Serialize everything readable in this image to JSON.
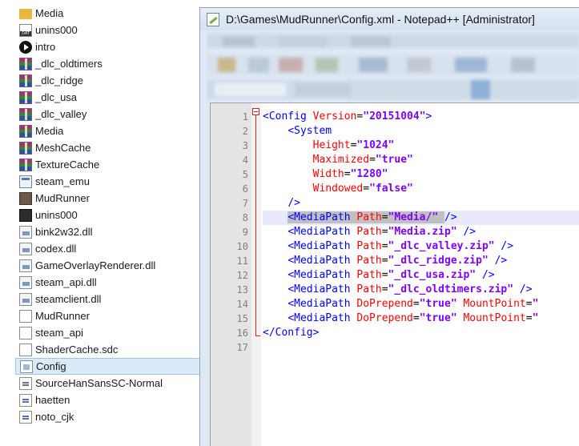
{
  "explorer": {
    "items": [
      {
        "label": "Media",
        "icon": "folder-icon"
      },
      {
        "label": "unins000",
        "icon": "dat-file-icon"
      },
      {
        "label": "intro",
        "icon": "video-play-icon"
      },
      {
        "label": "_dlc_oldtimers",
        "icon": "rar-archive-icon"
      },
      {
        "label": "_dlc_ridge",
        "icon": "rar-archive-icon"
      },
      {
        "label": "_dlc_usa",
        "icon": "rar-archive-icon"
      },
      {
        "label": "_dlc_valley",
        "icon": "rar-archive-icon"
      },
      {
        "label": "Media",
        "icon": "rar-archive-icon"
      },
      {
        "label": "MeshCache",
        "icon": "rar-archive-icon"
      },
      {
        "label": "TextureCache",
        "icon": "rar-archive-icon"
      },
      {
        "label": "steam_emu",
        "icon": "application-icon"
      },
      {
        "label": "MudRunner",
        "icon": "game-app-icon"
      },
      {
        "label": "unins000",
        "icon": "setup-app-icon"
      },
      {
        "label": "bink2w32.dll",
        "icon": "dll-file-icon"
      },
      {
        "label": "codex.dll",
        "icon": "dll-file-icon"
      },
      {
        "label": "GameOverlayRenderer.dll",
        "icon": "dll-file-icon"
      },
      {
        "label": "steam_api.dll",
        "icon": "dll-file-icon"
      },
      {
        "label": "steamclient.dll",
        "icon": "dll-file-icon"
      },
      {
        "label": "MudRunner",
        "icon": "blank-file-icon"
      },
      {
        "label": "steam_api",
        "icon": "blank-file-icon"
      },
      {
        "label": "ShaderCache.sdc",
        "icon": "blank-file-icon"
      },
      {
        "label": "Config",
        "icon": "config-file-icon",
        "selected": true
      },
      {
        "label": "SourceHanSansSC-Normal",
        "icon": "font-file-icon"
      },
      {
        "label": "haetten",
        "icon": "font-file-icon"
      },
      {
        "label": "noto_cjk",
        "icon": "font-file-icon"
      }
    ]
  },
  "notepad": {
    "title": "D:\\Games\\MudRunner\\Config.xml - Notepad++ [Administrator]",
    "highlighted_line": 8,
    "lines": [
      {
        "n": "1",
        "tokens": [
          {
            "t": "<Config ",
            "c": "tag"
          },
          {
            "t": "Version",
            "c": "attr"
          },
          {
            "t": "=",
            "c": "eq"
          },
          {
            "t": "\"20151004\"",
            "c": "val"
          },
          {
            "t": ">",
            "c": "tag"
          }
        ]
      },
      {
        "n": "2",
        "tokens": [
          {
            "t": "    ",
            "c": "eq"
          },
          {
            "t": "<System",
            "c": "tag"
          }
        ]
      },
      {
        "n": "3",
        "tokens": [
          {
            "t": "        ",
            "c": "eq"
          },
          {
            "t": "Height",
            "c": "attr"
          },
          {
            "t": "=",
            "c": "eq"
          },
          {
            "t": "\"1024\"",
            "c": "val"
          }
        ]
      },
      {
        "n": "4",
        "tokens": [
          {
            "t": "        ",
            "c": "eq"
          },
          {
            "t": "Maximized",
            "c": "attr"
          },
          {
            "t": "=",
            "c": "eq"
          },
          {
            "t": "\"true\"",
            "c": "val"
          }
        ]
      },
      {
        "n": "5",
        "tokens": [
          {
            "t": "        ",
            "c": "eq"
          },
          {
            "t": "Width",
            "c": "attr"
          },
          {
            "t": "=",
            "c": "eq"
          },
          {
            "t": "\"1280\"",
            "c": "val"
          }
        ]
      },
      {
        "n": "6",
        "tokens": [
          {
            "t": "        ",
            "c": "eq"
          },
          {
            "t": "Windowed",
            "c": "attr"
          },
          {
            "t": "=",
            "c": "eq"
          },
          {
            "t": "\"false\"",
            "c": "val"
          }
        ]
      },
      {
        "n": "7",
        "tokens": [
          {
            "t": "    ",
            "c": "eq"
          },
          {
            "t": "/>",
            "c": "tag"
          }
        ]
      },
      {
        "n": "8",
        "tokens": [
          {
            "t": "    ",
            "c": "eq"
          },
          {
            "t": "<MediaPath ",
            "c": "tag",
            "sel": true
          },
          {
            "t": "Path",
            "c": "attr",
            "sel": true
          },
          {
            "t": "=",
            "c": "eq",
            "sel": true
          },
          {
            "t": "\"Media/\"",
            "c": "val",
            "sel": true
          },
          {
            "t": " ",
            "c": "eq",
            "sel": true
          },
          {
            "t": "/>",
            "c": "tag"
          }
        ]
      },
      {
        "n": "9",
        "tokens": [
          {
            "t": "    ",
            "c": "eq"
          },
          {
            "t": "<MediaPath ",
            "c": "tag"
          },
          {
            "t": "Path",
            "c": "attr"
          },
          {
            "t": "=",
            "c": "eq"
          },
          {
            "t": "\"Media.zip\"",
            "c": "val"
          },
          {
            "t": " />",
            "c": "tag"
          }
        ]
      },
      {
        "n": "10",
        "tokens": [
          {
            "t": "    ",
            "c": "eq"
          },
          {
            "t": "<MediaPath ",
            "c": "tag"
          },
          {
            "t": "Path",
            "c": "attr"
          },
          {
            "t": "=",
            "c": "eq"
          },
          {
            "t": "\"_dlc_valley.zip\"",
            "c": "val"
          },
          {
            "t": " />",
            "c": "tag"
          }
        ]
      },
      {
        "n": "11",
        "tokens": [
          {
            "t": "    ",
            "c": "eq"
          },
          {
            "t": "<MediaPath ",
            "c": "tag"
          },
          {
            "t": "Path",
            "c": "attr"
          },
          {
            "t": "=",
            "c": "eq"
          },
          {
            "t": "\"_dlc_ridge.zip\"",
            "c": "val"
          },
          {
            "t": " />",
            "c": "tag"
          }
        ]
      },
      {
        "n": "12",
        "tokens": [
          {
            "t": "    ",
            "c": "eq"
          },
          {
            "t": "<MediaPath ",
            "c": "tag"
          },
          {
            "t": "Path",
            "c": "attr"
          },
          {
            "t": "=",
            "c": "eq"
          },
          {
            "t": "\"_dlc_usa.zip\"",
            "c": "val"
          },
          {
            "t": " />",
            "c": "tag"
          }
        ]
      },
      {
        "n": "13",
        "tokens": [
          {
            "t": "    ",
            "c": "eq"
          },
          {
            "t": "<MediaPath ",
            "c": "tag"
          },
          {
            "t": "Path",
            "c": "attr"
          },
          {
            "t": "=",
            "c": "eq"
          },
          {
            "t": "\"_dlc_oldtimers.zip\"",
            "c": "val"
          },
          {
            "t": " />",
            "c": "tag"
          }
        ]
      },
      {
        "n": "14",
        "tokens": [
          {
            "t": "    ",
            "c": "eq"
          },
          {
            "t": "<MediaPath ",
            "c": "tag"
          },
          {
            "t": "DoPrepend",
            "c": "attr"
          },
          {
            "t": "=",
            "c": "eq"
          },
          {
            "t": "\"true\"",
            "c": "val"
          },
          {
            "t": " ",
            "c": "eq"
          },
          {
            "t": "MountPoint",
            "c": "attr"
          },
          {
            "t": "=",
            "c": "eq"
          },
          {
            "t": "\"",
            "c": "val"
          }
        ]
      },
      {
        "n": "15",
        "tokens": [
          {
            "t": "    ",
            "c": "eq"
          },
          {
            "t": "<MediaPath ",
            "c": "tag"
          },
          {
            "t": "DoPrepend",
            "c": "attr"
          },
          {
            "t": "=",
            "c": "eq"
          },
          {
            "t": "\"true\"",
            "c": "val"
          },
          {
            "t": " ",
            "c": "eq"
          },
          {
            "t": "MountPoint",
            "c": "attr"
          },
          {
            "t": "=",
            "c": "eq"
          },
          {
            "t": "\"",
            "c": "val"
          }
        ]
      },
      {
        "n": "16",
        "tokens": [
          {
            "t": "</Config>",
            "c": "tag"
          }
        ]
      },
      {
        "n": "17",
        "tokens": []
      }
    ]
  },
  "colors": {
    "tag": "#0000ff",
    "attr": "#ff0000",
    "value": "#8000ff",
    "selection": "#c0c0c0",
    "current_line": "#e8e8ff",
    "explorer_selected": "#dbe9f9"
  }
}
